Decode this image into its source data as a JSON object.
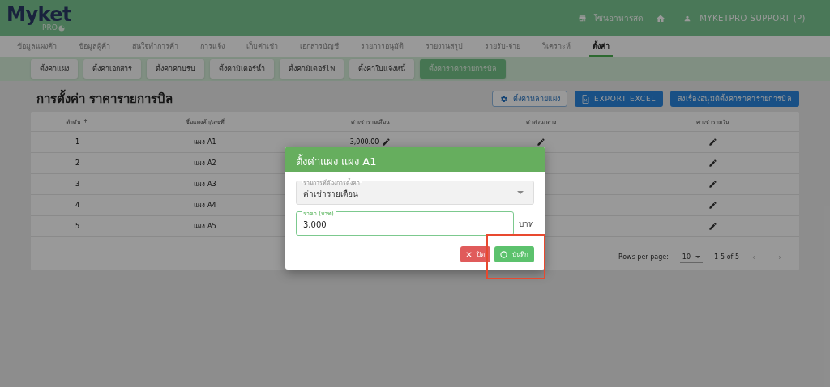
{
  "header": {
    "logo": "Myket",
    "logo_sub": "PRO",
    "zone": "โซนอาหารสด",
    "user": "MYKETPRO SUPPORT (P)"
  },
  "nav": [
    {
      "label": "ข้อมูลแผงค้า",
      "selected": false
    },
    {
      "label": "ข้อมูลผู้ค้า",
      "selected": false
    },
    {
      "label": "สนใจทำการค้า",
      "selected": false
    },
    {
      "label": "การแจ้ง",
      "selected": false
    },
    {
      "label": "เก็บค่าเช่า",
      "selected": false
    },
    {
      "label": "เอกสารบัญชี",
      "selected": false
    },
    {
      "label": "รายการอนุมัติ",
      "selected": false
    },
    {
      "label": "รายงานสรุป",
      "selected": false
    },
    {
      "label": "รายรับ-จ่าย",
      "selected": false
    },
    {
      "label": "วิเคราะห์",
      "selected": false
    },
    {
      "label": "ตั้งค่า",
      "selected": true
    }
  ],
  "subtabs": [
    {
      "label": "ตั้งค่าแผง",
      "selected": false
    },
    {
      "label": "ตั้งค่าเอกสาร",
      "selected": false
    },
    {
      "label": "ตั้งค่าค่าปรับ",
      "selected": false
    },
    {
      "label": "ตั้งค่ามิเตอร์น้ำ",
      "selected": false
    },
    {
      "label": "ตั้งค่ามิเตอร์ไฟ",
      "selected": false
    },
    {
      "label": "ตั้งค่าใบแจ้งหนี้",
      "selected": false
    },
    {
      "label": "ตั้งค่าราคารายการบิล",
      "selected": true
    }
  ],
  "page_title": "การตั้งค่า ราคารายการบิล",
  "actions": [
    {
      "kind": "outline",
      "label": "ตั้งค่าหลายแผง"
    },
    {
      "kind": "excel",
      "label": "EXPORT EXCEL"
    },
    {
      "kind": "primary",
      "label": "ส่งเรื่องอนุมัติตั้งค่าราคารายการบิล"
    }
  ],
  "table": {
    "columns": [
      "ลำดับ",
      "ชื่อแผงค้า/เลขที่",
      "ค่าเช่ารายเดือน",
      "ค่าส่วนกลาง",
      "ค่าเช่ารายวัน"
    ],
    "rows": [
      {
        "no": "1",
        "name": "แผง A1",
        "monthly_rent": "3,000.00"
      },
      {
        "no": "2",
        "name": "แผง A2"
      },
      {
        "no": "3",
        "name": "แผง A3"
      },
      {
        "no": "4",
        "name": "แผง A4"
      },
      {
        "no": "5",
        "name": "แผง A5"
      }
    ],
    "pagination": {
      "rows_per_page_label": "Rows per page:",
      "rows_per_page": "10",
      "range": "1-5 of 5"
    }
  },
  "dialog": {
    "title": "ตั้งค่าแผง แผง A1",
    "select_label": "รายการที่ต้องการตั้งค่า",
    "select_value": "ค่าเช่ารายเดือน",
    "price_label": "ราคา (บาท)",
    "price_value": "3,000",
    "unit": "บาท",
    "close": "ปิด",
    "save": "บันทึก"
  }
}
